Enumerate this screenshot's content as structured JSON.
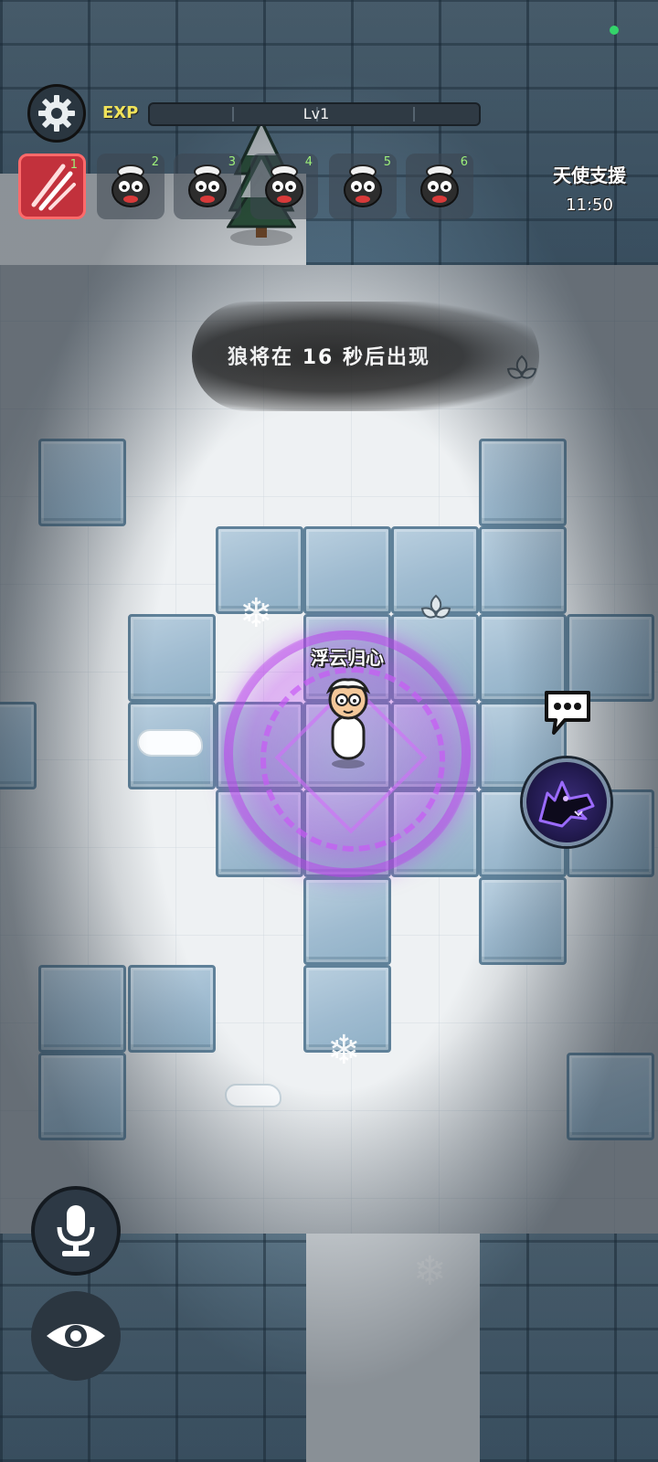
{
  "hud": {
    "exp_label": "EXP",
    "level_label": "Lv1",
    "angel_support_label": "天使支援",
    "angel_support_timer": "11:50"
  },
  "slots": [
    {
      "number": "1",
      "icon": "claw-attack-icon",
      "active": true
    },
    {
      "number": "2",
      "icon": "sheep-face-icon",
      "active": false
    },
    {
      "number": "3",
      "icon": "sheep-face-icon",
      "active": false
    },
    {
      "number": "4",
      "icon": "sheep-face-icon",
      "active": false
    },
    {
      "number": "5",
      "icon": "sheep-face-icon",
      "active": false
    },
    {
      "number": "6",
      "icon": "sheep-face-icon",
      "active": false
    }
  ],
  "banner": {
    "text": "狼将在 16 秒后出现"
  },
  "player": {
    "name": "浮云归心"
  },
  "controls": {
    "settings_icon": "gear-icon",
    "chat_icon": "chat-bubble-icon",
    "skill_icon": "wolf-howl-icon",
    "mic_icon": "microphone-icon",
    "view_icon": "eye-icon"
  },
  "colors": {
    "active_slot": "#c2313c",
    "skill_glow": "#7b4dff",
    "magic_circle": "#b946eb",
    "status_dot": "#34d46a"
  }
}
